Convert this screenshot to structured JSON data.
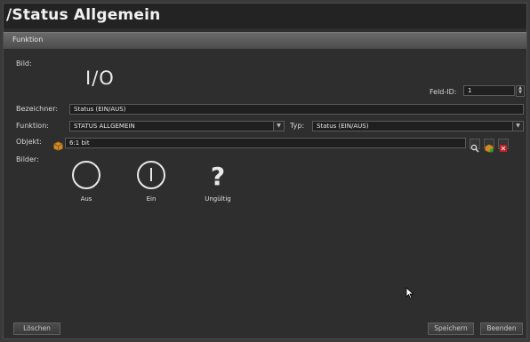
{
  "header": {
    "title": "/Status Allgemein"
  },
  "section": {
    "title": "Funktion"
  },
  "form": {
    "bild_label": "Bild:",
    "bild_value": "I/O",
    "feld_id_label": "Feld-ID:",
    "feld_id_value": "1",
    "bezeichner_label": "Bezeichner:",
    "bezeichner_value": "Status (EIN/AUS)",
    "funktion_label": "Funktion:",
    "funktion_value": "STATUS ALLGEMEIN",
    "typ_label": "Typ:",
    "typ_value": "Status (EIN/AUS)",
    "objekt_label": "Objekt:",
    "objekt_value": "6:1 bit",
    "bilder_label": "Bilder:"
  },
  "states": [
    {
      "label": "Aus",
      "icon": "circle-off-icon"
    },
    {
      "label": "Ein",
      "icon": "circle-on-icon"
    },
    {
      "label": "Ungültig",
      "icon": "question-icon"
    }
  ],
  "buttons": {
    "delete": "Löschen",
    "save": "Speichern",
    "close": "Beenden"
  },
  "colors": {
    "background": "#2e2e2e",
    "field": "#1f1f1f",
    "delete_red": "#c02020",
    "object_orange": "#d08a2a"
  }
}
